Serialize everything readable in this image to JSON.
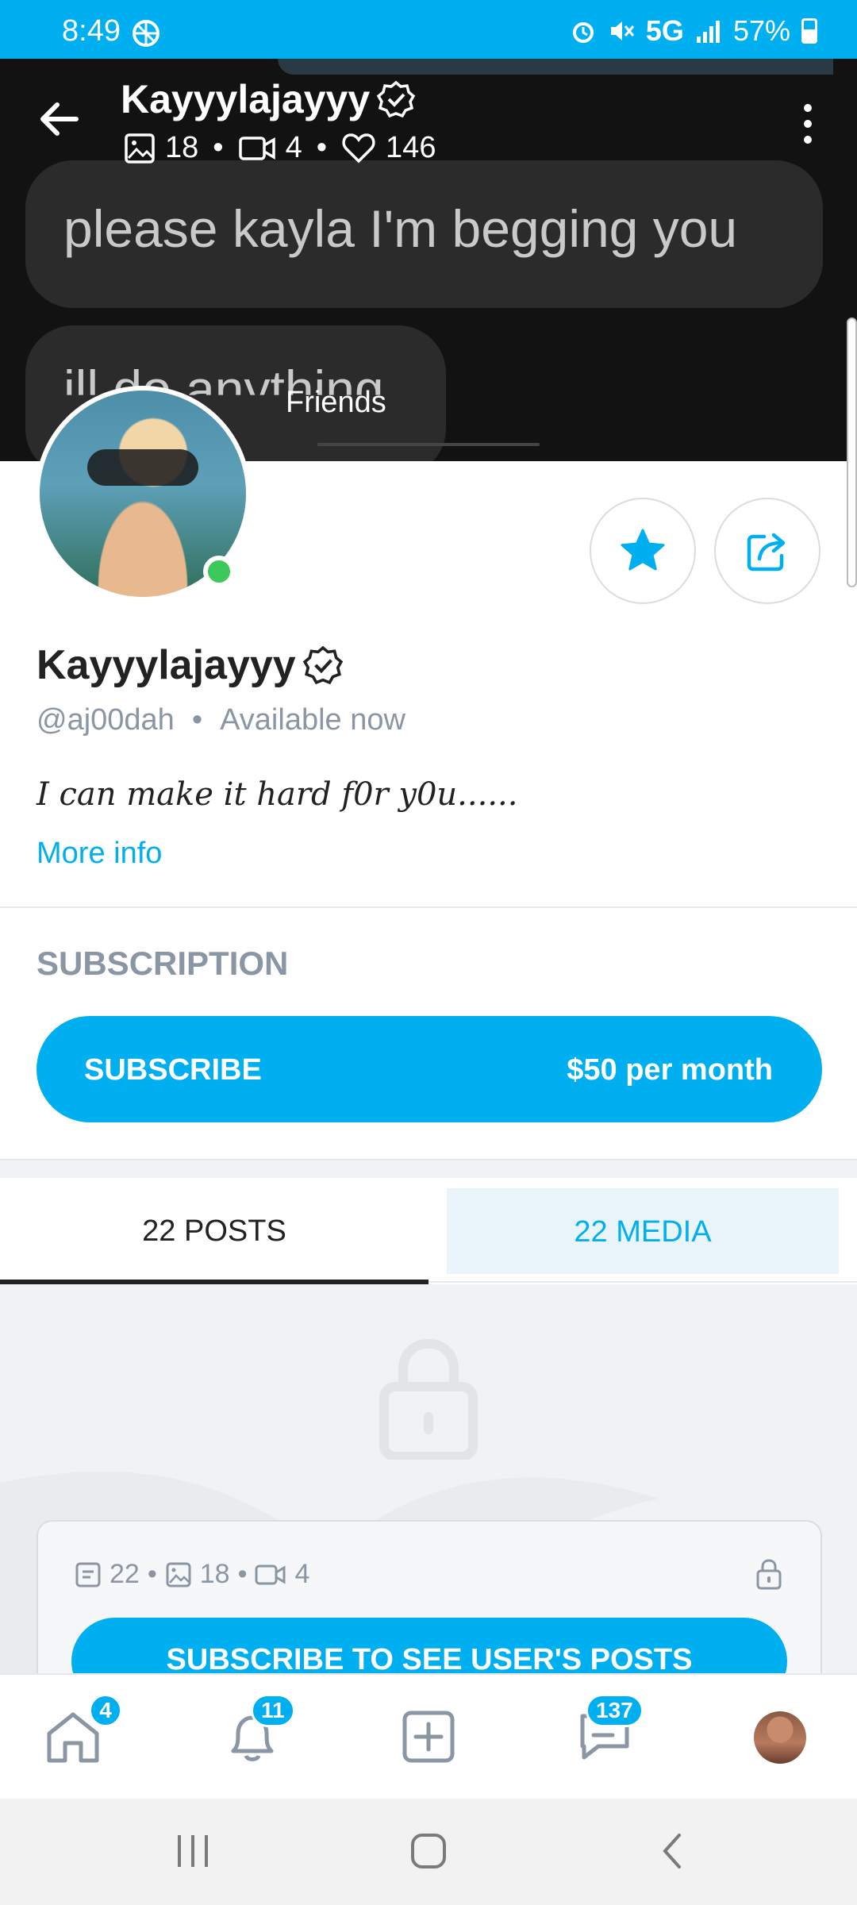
{
  "status_bar": {
    "time": "8:49",
    "network": "5G",
    "battery": "57%"
  },
  "cover": {
    "message_line_1": "please kayla I'm begging you",
    "message_line_2": "ill do anything",
    "overlay_label": "Friends"
  },
  "header": {
    "name": "Kayyylajayyy",
    "photos_count": "18",
    "videos_count": "4",
    "likes_count": "146"
  },
  "profile": {
    "name": "Kayyylajayyy",
    "handle": "@aj00dah",
    "availability": "Available now",
    "bio": "I can make it hard f0r y0u......",
    "more_info": "More info"
  },
  "subscription": {
    "title": "SUBSCRIPTION",
    "button_label": "SUBSCRIBE",
    "price": "$50 per month"
  },
  "tabs": [
    {
      "label": "22 POSTS",
      "active": true
    },
    {
      "label": "22 MEDIA",
      "active": false
    }
  ],
  "locked_card": {
    "posts_count": "22",
    "photos_count": "18",
    "videos_count": "4",
    "cta": "SUBSCRIBE TO SEE USER'S POSTS"
  },
  "bottom_nav": {
    "home_badge": "4",
    "notifications_badge": "11",
    "messages_badge": "137"
  },
  "colors": {
    "accent": "#00aff0",
    "online": "#3cc85a"
  }
}
